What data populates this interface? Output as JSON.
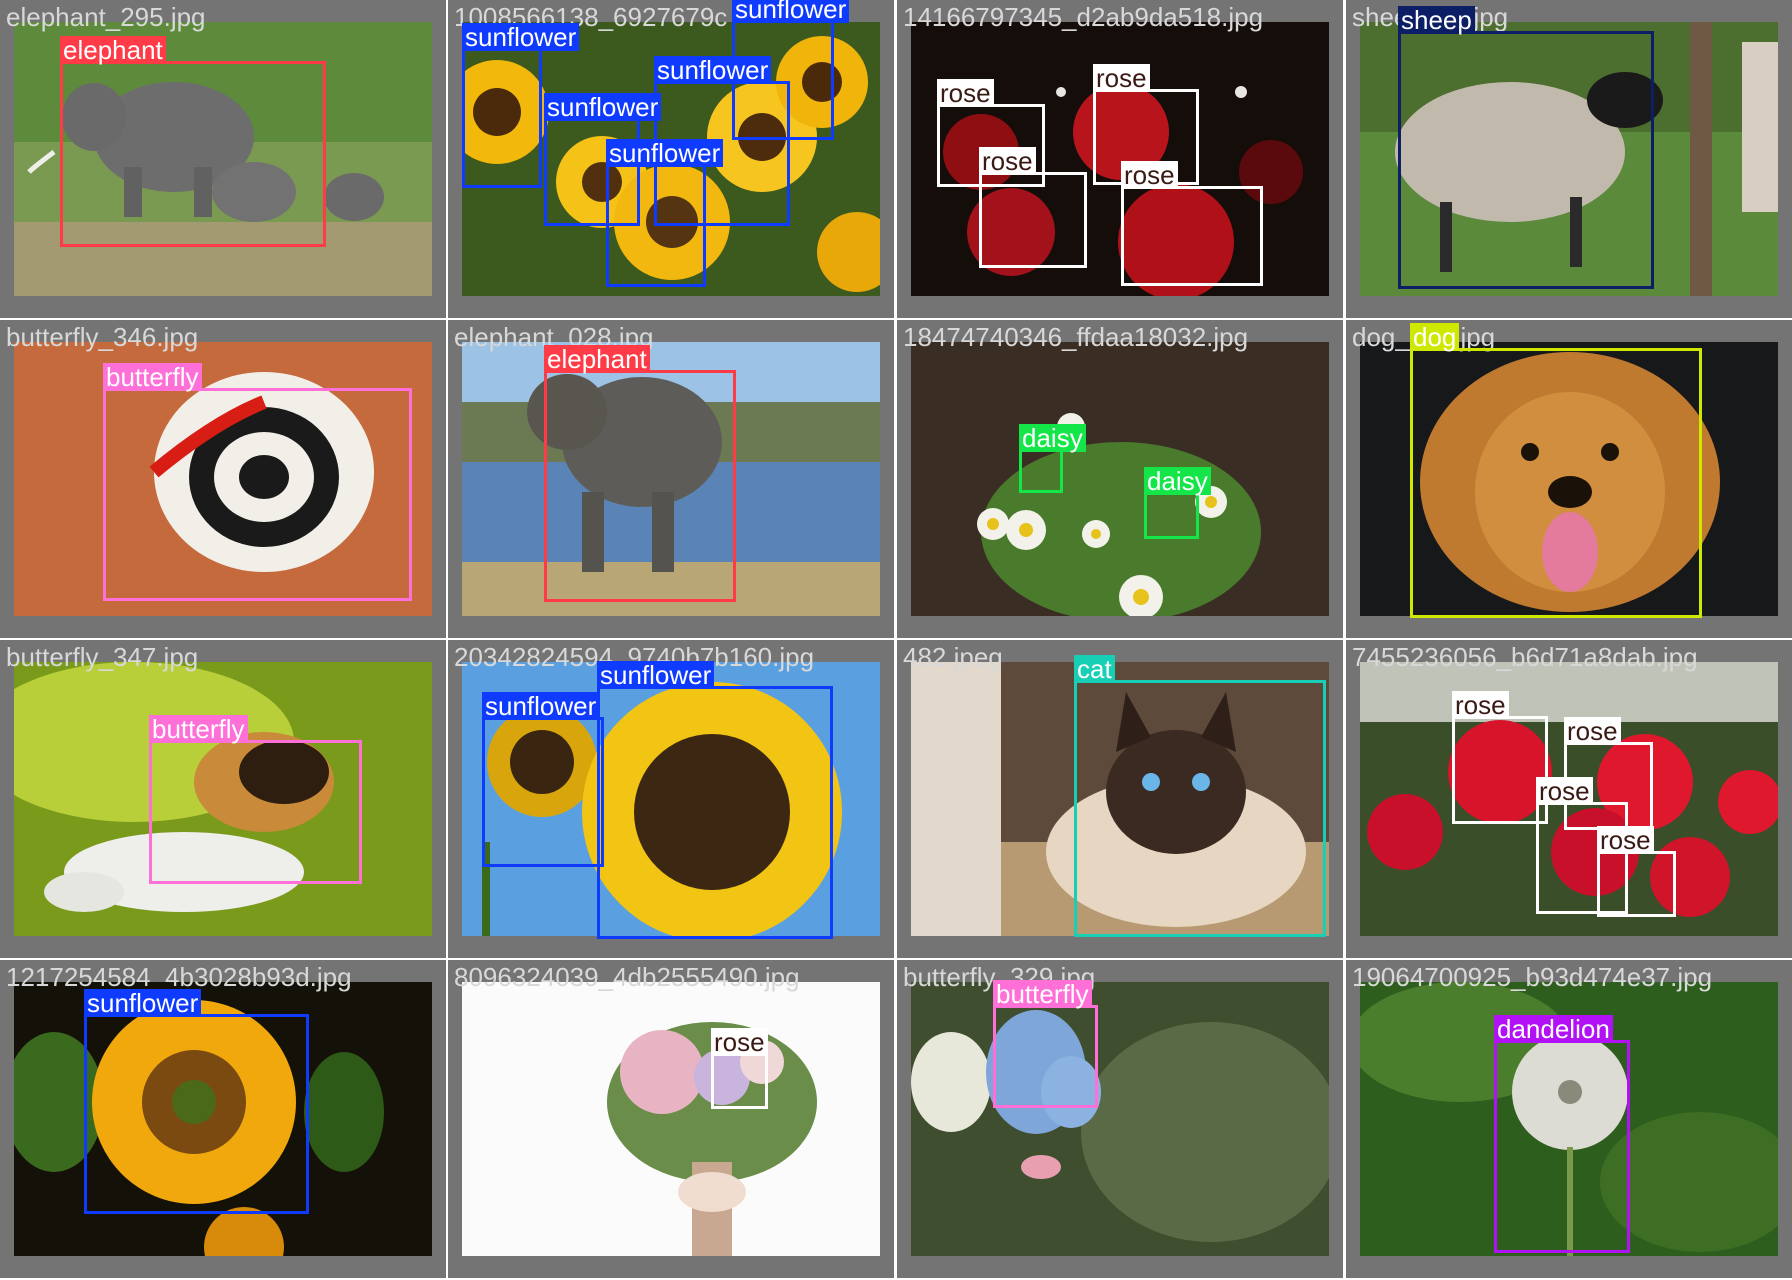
{
  "classes": {
    "elephant": {
      "color": "#ff3b48",
      "text": "#ffffff"
    },
    "sunflower": {
      "color": "#0f3bff",
      "text": "#ffffff"
    },
    "rose": {
      "color": "#ffffff",
      "text": "#3a1a14"
    },
    "sheep": {
      "color": "#0c1e66",
      "text": "#ffffff"
    },
    "butterfly": {
      "color": "#ff6fd8",
      "text": "#ffffff"
    },
    "daisy": {
      "color": "#14e64a",
      "text": "#ffffff"
    },
    "dog": {
      "color": "#cfe800",
      "text": "#ffffff"
    },
    "cat": {
      "color": "#17cfb4",
      "text": "#ffffff"
    },
    "dandelion": {
      "color": "#b311f5",
      "text": "#ffffff"
    }
  },
  "tiles": [
    {
      "filename": "elephant_295.jpg",
      "detections": [
        {
          "label": "elephant",
          "class": "elephant"
        }
      ]
    },
    {
      "filename": "1008566138_6927679c",
      "detections": [
        {
          "label": "sunflower",
          "class": "sunflower"
        },
        {
          "label": "sunflower",
          "class": "sunflower"
        },
        {
          "label": "sunflower",
          "class": "sunflower"
        },
        {
          "label": "sunflower",
          "class": "sunflower"
        },
        {
          "label": "sunflower",
          "class": "sunflower"
        }
      ]
    },
    {
      "filename": "14166797345_d2ab9da518.jpg",
      "detections": [
        {
          "label": "rose",
          "class": "rose"
        },
        {
          "label": "rose",
          "class": "rose"
        },
        {
          "label": "rose",
          "class": "rose"
        },
        {
          "label": "rose",
          "class": "rose"
        }
      ]
    },
    {
      "filename": "sheep604.jpg",
      "detections": [
        {
          "label": "sheep",
          "class": "sheep"
        }
      ]
    },
    {
      "filename": "butterfly_346.jpg",
      "detections": [
        {
          "label": "butterfly",
          "class": "butterfly"
        }
      ]
    },
    {
      "filename": "elephant_028.jpg",
      "detections": [
        {
          "label": "elephant",
          "class": "elephant"
        }
      ]
    },
    {
      "filename": "18474740346_ffdaa18032.jpg",
      "detections": [
        {
          "label": "daisy",
          "class": "daisy"
        },
        {
          "label": "daisy",
          "class": "daisy"
        }
      ]
    },
    {
      "filename": "dog_324.jpg",
      "detections": [
        {
          "label": "dog",
          "class": "dog"
        }
      ]
    },
    {
      "filename": "butterfly_347.jpg",
      "detections": [
        {
          "label": "butterfly",
          "class": "butterfly"
        }
      ]
    },
    {
      "filename": "20342824594_9740b7b160.jpg",
      "detections": [
        {
          "label": "sunflower",
          "class": "sunflower"
        },
        {
          "label": "sunflower",
          "class": "sunflower"
        }
      ]
    },
    {
      "filename": "482.jpeg",
      "detections": [
        {
          "label": "cat",
          "class": "cat"
        }
      ]
    },
    {
      "filename": "7455236056_b6d71a8dab.jpg",
      "detections": [
        {
          "label": "rose",
          "class": "rose"
        },
        {
          "label": "rose",
          "class": "rose"
        },
        {
          "label": "rose",
          "class": "rose"
        },
        {
          "label": "rose",
          "class": "rose"
        }
      ]
    },
    {
      "filename": "1217254584_4b3028b93d.jpg",
      "detections": [
        {
          "label": "sunflower",
          "class": "sunflower"
        }
      ]
    },
    {
      "filename": "8096324039_4db2555490.jpg",
      "detections": [
        {
          "label": "rose",
          "class": "rose"
        }
      ]
    },
    {
      "filename": "butterfly_329.jpg",
      "detections": [
        {
          "label": "butterfly",
          "class": "butterfly"
        }
      ]
    },
    {
      "filename": "19064700925_b93d474e37.jpg",
      "detections": [
        {
          "label": "dandelion",
          "class": "dandelion"
        }
      ]
    }
  ]
}
